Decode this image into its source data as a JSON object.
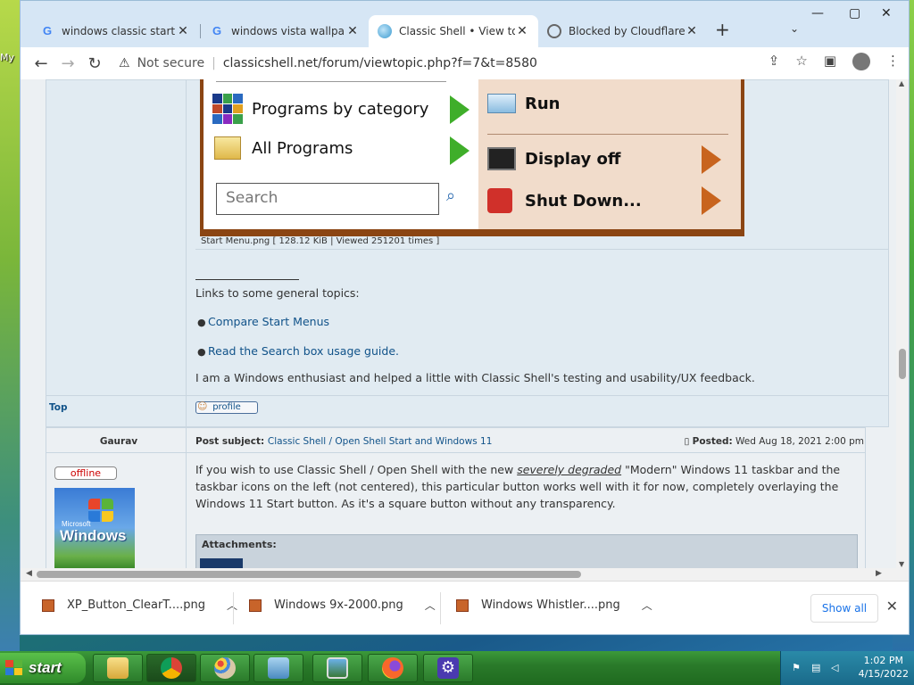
{
  "desktop": {
    "label": "My"
  },
  "tabs": [
    {
      "title": "windows classic start bu",
      "favicon": "google-icon",
      "active": false
    },
    {
      "title": "windows vista wallpape",
      "favicon": "google-icon",
      "active": false
    },
    {
      "title": "Classic Shell • View top",
      "favicon": "classicshell-icon",
      "active": true
    },
    {
      "title": "Blocked by Cloudflare C",
      "favicon": "cloudflare-icon",
      "active": false
    }
  ],
  "window_controls": {
    "minimize": "—",
    "maximize": "▢",
    "close": "✕"
  },
  "addressbar": {
    "security": "Not secure",
    "url": "classicshell.net/forum/viewtopic.php?f=7&t=8580"
  },
  "startmenu": {
    "left_items": [
      {
        "label": "Programs by category",
        "icon": "programs-category-icon"
      },
      {
        "label": "All Programs",
        "icon": "all-programs-icon"
      }
    ],
    "search_placeholder": "Search",
    "right_items": [
      {
        "label": "Run",
        "icon": "run-icon"
      },
      {
        "label": "Display off",
        "icon": "display-off-icon"
      },
      {
        "label": "Shut Down...",
        "icon": "shutdown-icon"
      }
    ]
  },
  "attachment_caption": "Start Menu.png [ 128.12 KiB | Viewed 251201 times ]",
  "signature": {
    "links_intro": "Links to some general topics:",
    "link1": "Compare Start Menus",
    "link2": "Read the Search box usage guide.",
    "about": "I am a Windows enthusiast and helped a little with Classic Shell's testing and usability/UX feedback."
  },
  "post1_footer": {
    "top_link": "Top",
    "profile_button": "profile"
  },
  "post2": {
    "author": "Gaurav",
    "status": "offline",
    "avatar": {
      "small_text": "Microsoft",
      "big_text": "Windows"
    },
    "subject_label": "Post subject:",
    "subject": "Classic Shell / Open Shell Start and Windows 11",
    "posted_label": "Posted:",
    "posted_date": "Wed Aug 18, 2021 2:00 pm",
    "body_part1": "If you wish to use Classic Shell / Open Shell with the new ",
    "body_emph": "severely degraded",
    "body_part2": " \"Modern\" Windows 11 taskbar and the taskbar icons on the left (not centered), this particular button works well with it for now, completely overlaying the Windows 11 Start button. As it's a square button without any transparency.",
    "attachments_label": "Attachments:"
  },
  "downloads": [
    {
      "name": "XP_Button_ClearT....png"
    },
    {
      "name": "Windows 9x-2000.png"
    },
    {
      "name": "Windows Whistler....png"
    }
  ],
  "downloads_show_all": "Show all",
  "taskbar": {
    "start_label": "start",
    "apps": [
      "file-explorer-icon",
      "chrome-icon",
      "paint-icon",
      "control-panel-icon",
      "photos-icon",
      "firefox-icon",
      "settings-icon"
    ],
    "time": "1:02 PM",
    "date": "4/15/2022"
  }
}
